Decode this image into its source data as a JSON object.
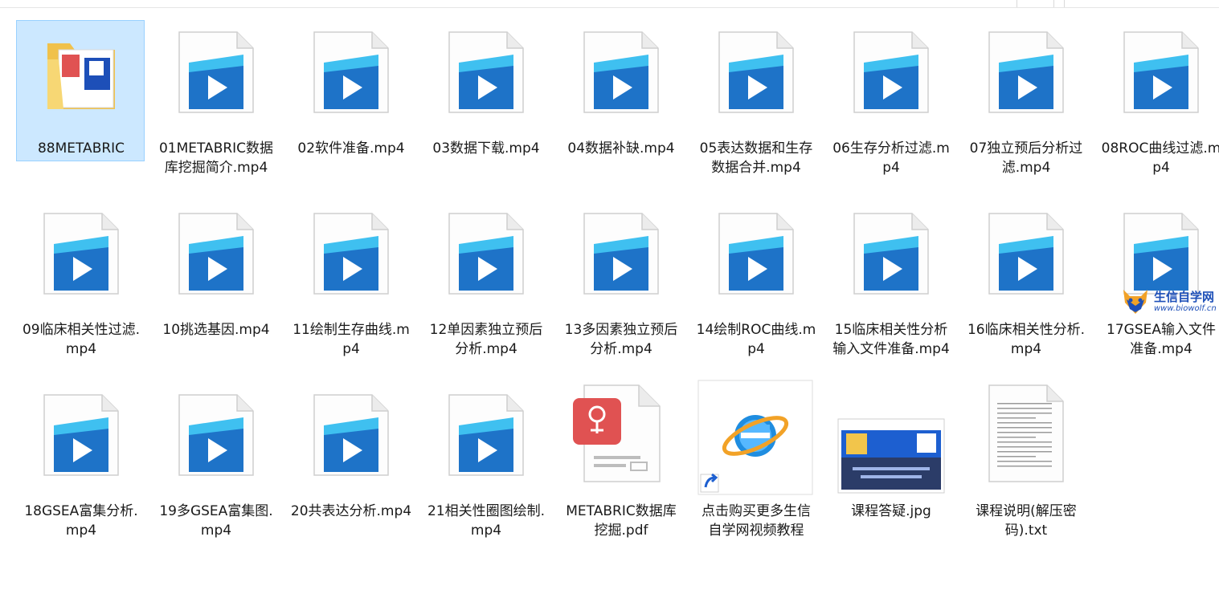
{
  "items": [
    {
      "name": "88METABRIC",
      "type": "folder",
      "selected": true
    },
    {
      "name": "01METABRIC数据库挖掘简介.mp4",
      "type": "video"
    },
    {
      "name": "02软件准备.mp4",
      "type": "video"
    },
    {
      "name": "03数据下载.mp4",
      "type": "video"
    },
    {
      "name": "04数据补缺.mp4",
      "type": "video"
    },
    {
      "name": "05表达数据和生存数据合并.mp4",
      "type": "video"
    },
    {
      "name": "06生存分析过滤.mp4",
      "type": "video"
    },
    {
      "name": "07独立预后分析过滤.mp4",
      "type": "video"
    },
    {
      "name": "08ROC曲线过滤.mp4",
      "type": "video"
    },
    {
      "name": "09临床相关性过滤.mp4",
      "type": "video"
    },
    {
      "name": "10挑选基因.mp4",
      "type": "video"
    },
    {
      "name": "11绘制生存曲线.mp4",
      "type": "video"
    },
    {
      "name": "12单因素独立预后分析.mp4",
      "type": "video"
    },
    {
      "name": "13多因素独立预后分析.mp4",
      "type": "video"
    },
    {
      "name": "14绘制ROC曲线.mp4",
      "type": "video"
    },
    {
      "name": "15临床相关性分析输入文件准备.mp4",
      "type": "video"
    },
    {
      "name": "16临床相关性分析.mp4",
      "type": "video"
    },
    {
      "name": "17GSEA输入文件准备.mp4",
      "type": "video"
    },
    {
      "name": "18GSEA富集分析.mp4",
      "type": "video"
    },
    {
      "name": "19多GSEA富集图.mp4",
      "type": "video"
    },
    {
      "name": "20共表达分析.mp4",
      "type": "video"
    },
    {
      "name": "21相关性圈图绘制.mp4",
      "type": "video"
    },
    {
      "name": "METABRIC数据库挖掘.pdf",
      "type": "pdf"
    },
    {
      "name": "点击购买更多生信自学网视频教程",
      "type": "shortcut"
    },
    {
      "name": "课程答疑.jpg",
      "type": "image"
    },
    {
      "name": "课程说明(解压密码).txt",
      "type": "text"
    }
  ],
  "watermark": {
    "title": "生信自学网",
    "url": "www.biowolf.cn"
  },
  "colors": {
    "selection_bg": "#cce8ff",
    "selection_border": "#99d1ff",
    "video_blue": "#1e73c8",
    "pdf_red": "#e05252"
  }
}
